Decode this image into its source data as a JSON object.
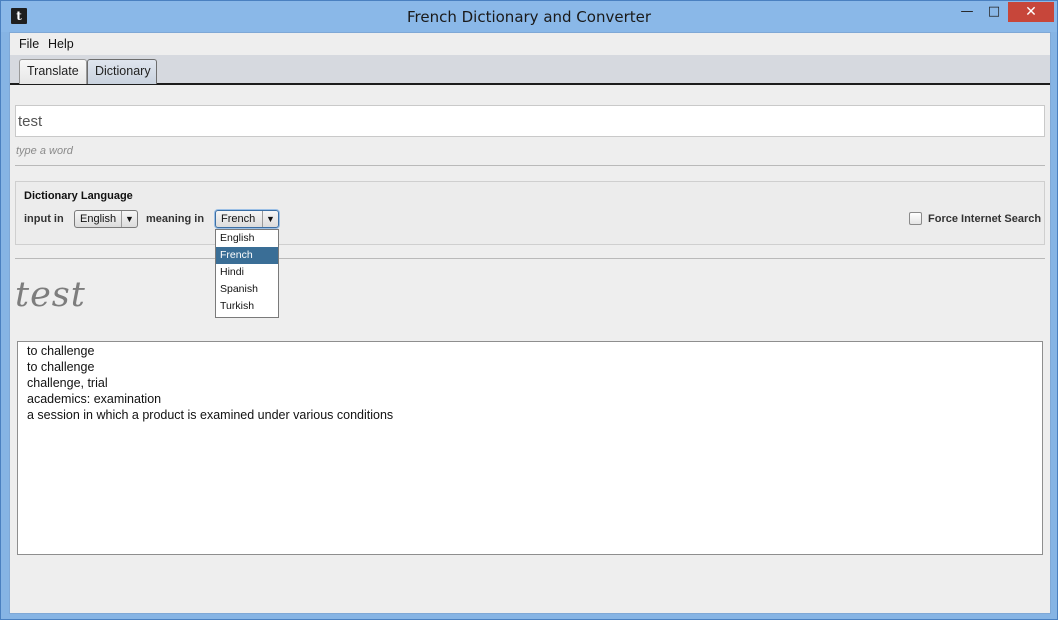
{
  "window": {
    "title": "French Dictionary and Converter",
    "app_icon_glyph": "t",
    "min_glyph": "—",
    "max_glyph": "□",
    "close_glyph": "✕"
  },
  "menu": [
    {
      "label": "File"
    },
    {
      "label": "Help"
    }
  ],
  "tabs": [
    {
      "label": "Translate",
      "active": false
    },
    {
      "label": "Dictionary",
      "active": true
    }
  ],
  "search": {
    "value": "test",
    "hint": "type a word"
  },
  "language_panel": {
    "title": "Dictionary Language",
    "input_label": "input in",
    "input_value": "English",
    "meaning_label": "meaning in",
    "meaning_value": "French",
    "force_label": "Force Internet Search",
    "force_checked": false
  },
  "dropdown": {
    "options": [
      "English",
      "French",
      "Hindi",
      "Spanish",
      "Turkish"
    ],
    "selected": "French"
  },
  "result": {
    "word": "test",
    "lines": [
      "to challenge",
      "to challenge",
      "challenge, trial",
      "academics: examination",
      "a session in which a product is examined under various conditions"
    ]
  },
  "colors": {
    "titlebar": "#8ab8e8",
    "close_button": "#c7463a",
    "selected_option": "#3a6e96"
  }
}
